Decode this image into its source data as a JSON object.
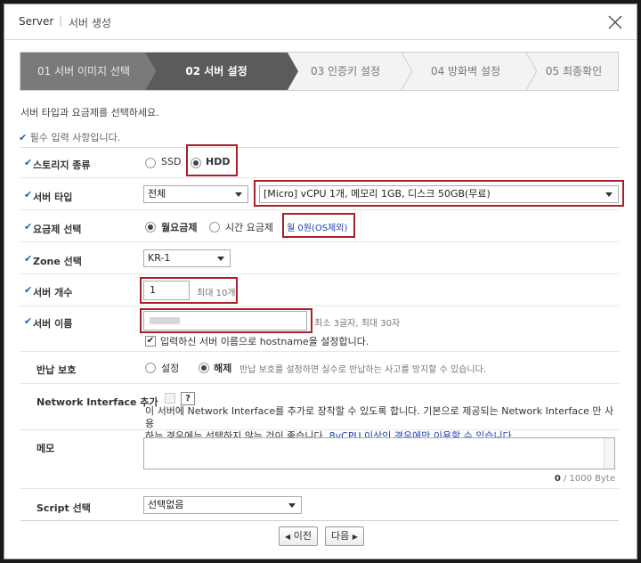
{
  "title": {
    "main": "Server",
    "separator": "|",
    "sub": "서버 생성"
  },
  "steps": [
    {
      "label": "01 서버 이미지 선택",
      "state": "done"
    },
    {
      "label": "02 서버 설정",
      "state": "active"
    },
    {
      "label": "03 인증키 설정",
      "state": "todo"
    },
    {
      "label": "04 방화벽 설정",
      "state": "todo"
    },
    {
      "label": "05 최종확인",
      "state": "todo"
    }
  ],
  "guide_text": "서버 타입과 요금제를 선택하세요.",
  "required_note": "필수 입력 사항입니다.",
  "check_mark": "✔",
  "form": {
    "storage": {
      "label": "스토리지 종류",
      "options": [
        "SSD",
        "HDD"
      ],
      "selected": "HDD"
    },
    "server_type": {
      "label": "서버 타입",
      "category": "전체",
      "spec": "[Micro] vCPU 1개, 메모리 1GB, 디스크 50GB(무료)"
    },
    "plan": {
      "label": "요금제 선택",
      "options": [
        "월요금제",
        "시간 요금제"
      ],
      "selected": "월요금제",
      "price": "월 0원(OS제외)"
    },
    "zone": {
      "label": "Zone 선택",
      "value": "KR-1"
    },
    "count": {
      "label": "서버 개수",
      "value": "1",
      "hint": "최대 10개"
    },
    "name": {
      "label": "서버 이름",
      "hint": "최소 3글자, 최대 30자",
      "hostname_label": "입력하신 서버 이름으로 hostname을 설정합니다."
    },
    "protect": {
      "label": "반납 보호",
      "options": [
        "설정",
        "해제"
      ],
      "selected": "해제",
      "hint": "반납 보호를 설정하면 실수로 반납하는 사고를 방지할 수 있습니다."
    },
    "nic": {
      "label": "Network Interface 추가",
      "help": "?",
      "desc_a": "이 서버에 Network Interface를 추가로 장착할 수 있도록 합니다. 기본으로 제공되는 Network Interface 만 사용",
      "desc_b": "하는 경우에는 선택하지 않는 것이 좋습니다.",
      "desc_c": "8vCPU 이상인 경우에만 이용할 수 있습니다."
    },
    "memo": {
      "label": "메모",
      "counter_current": "0",
      "counter_max": "/ 1000 Byte"
    },
    "script": {
      "label": "Script 선택",
      "value": "선택없음"
    }
  },
  "buttons": {
    "prev": "이전",
    "next": "다음"
  },
  "colors": {
    "active_step": "#5b5b5b",
    "highlight": "#a8202a",
    "accent": "#1e5fb3"
  }
}
